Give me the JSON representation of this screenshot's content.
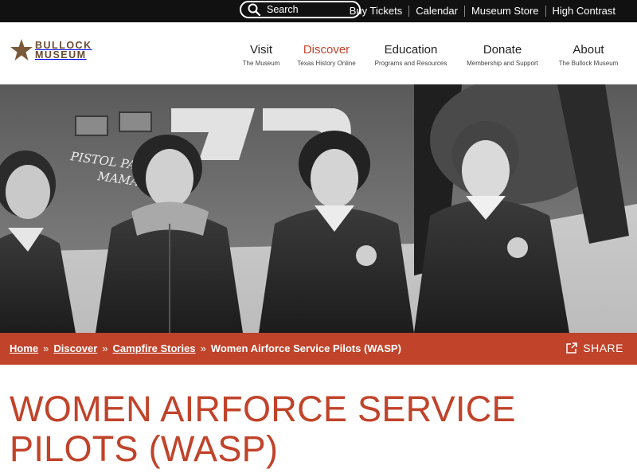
{
  "utility": {
    "search_placeholder": "Search",
    "links": [
      "Buy Tickets",
      "Calendar",
      "Museum Store",
      "High Contrast"
    ]
  },
  "logo": {
    "line1": "BULLOCK",
    "line2": "MUSEUM",
    "star_color": "#7a5a3a"
  },
  "nav": [
    {
      "label": "Visit",
      "sub": "The Museum"
    },
    {
      "label": "Discover",
      "sub": "Texas History Online"
    },
    {
      "label": "Education",
      "sub": "Programs and Resources"
    },
    {
      "label": "Donate",
      "sub": "Membership and Support"
    },
    {
      "label": "About",
      "sub": "The Bullock Museum"
    }
  ],
  "hero": {
    "plane_text_1": "PISTOL PACK",
    "plane_text_2": "MAMA"
  },
  "breadcrumb": {
    "items": [
      "Home",
      "Discover",
      "Campfire Stories"
    ],
    "current": "Women Airforce Service Pilots (WASP)",
    "separator": "»"
  },
  "share_label": "SHARE",
  "page_title": "Women Airforce Service Pilots (WASP)",
  "colors": {
    "accent": "#c0432a",
    "topbar": "#111111",
    "logo_brown": "#6a4a2e"
  }
}
